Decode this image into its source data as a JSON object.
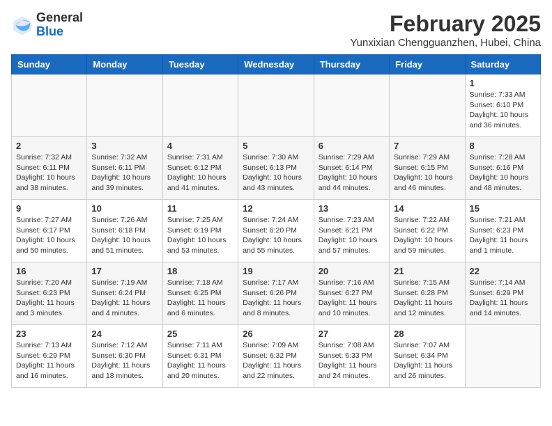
{
  "header": {
    "logo_general": "General",
    "logo_blue": "Blue",
    "month_title": "February 2025",
    "subtitle": "Yunxixian Chengguanzhen, Hubei, China"
  },
  "weekdays": [
    "Sunday",
    "Monday",
    "Tuesday",
    "Wednesday",
    "Thursday",
    "Friday",
    "Saturday"
  ],
  "weeks": [
    [
      {
        "day": "",
        "info": ""
      },
      {
        "day": "",
        "info": ""
      },
      {
        "day": "",
        "info": ""
      },
      {
        "day": "",
        "info": ""
      },
      {
        "day": "",
        "info": ""
      },
      {
        "day": "",
        "info": ""
      },
      {
        "day": "1",
        "info": "Sunrise: 7:33 AM\nSunset: 6:10 PM\nDaylight: 10 hours\nand 36 minutes."
      }
    ],
    [
      {
        "day": "2",
        "info": "Sunrise: 7:32 AM\nSunset: 6:11 PM\nDaylight: 10 hours\nand 38 minutes."
      },
      {
        "day": "3",
        "info": "Sunrise: 7:32 AM\nSunset: 6:11 PM\nDaylight: 10 hours\nand 39 minutes."
      },
      {
        "day": "4",
        "info": "Sunrise: 7:31 AM\nSunset: 6:12 PM\nDaylight: 10 hours\nand 41 minutes."
      },
      {
        "day": "5",
        "info": "Sunrise: 7:30 AM\nSunset: 6:13 PM\nDaylight: 10 hours\nand 43 minutes."
      },
      {
        "day": "6",
        "info": "Sunrise: 7:29 AM\nSunset: 6:14 PM\nDaylight: 10 hours\nand 44 minutes."
      },
      {
        "day": "7",
        "info": "Sunrise: 7:29 AM\nSunset: 6:15 PM\nDaylight: 10 hours\nand 46 minutes."
      },
      {
        "day": "8",
        "info": "Sunrise: 7:28 AM\nSunset: 6:16 PM\nDaylight: 10 hours\nand 48 minutes."
      }
    ],
    [
      {
        "day": "9",
        "info": "Sunrise: 7:27 AM\nSunset: 6:17 PM\nDaylight: 10 hours\nand 50 minutes."
      },
      {
        "day": "10",
        "info": "Sunrise: 7:26 AM\nSunset: 6:18 PM\nDaylight: 10 hours\nand 51 minutes."
      },
      {
        "day": "11",
        "info": "Sunrise: 7:25 AM\nSunset: 6:19 PM\nDaylight: 10 hours\nand 53 minutes."
      },
      {
        "day": "12",
        "info": "Sunrise: 7:24 AM\nSunset: 6:20 PM\nDaylight: 10 hours\nand 55 minutes."
      },
      {
        "day": "13",
        "info": "Sunrise: 7:23 AM\nSunset: 6:21 PM\nDaylight: 10 hours\nand 57 minutes."
      },
      {
        "day": "14",
        "info": "Sunrise: 7:22 AM\nSunset: 6:22 PM\nDaylight: 10 hours\nand 59 minutes."
      },
      {
        "day": "15",
        "info": "Sunrise: 7:21 AM\nSunset: 6:23 PM\nDaylight: 11 hours\nand 1 minute."
      }
    ],
    [
      {
        "day": "16",
        "info": "Sunrise: 7:20 AM\nSunset: 6:23 PM\nDaylight: 11 hours\nand 3 minutes."
      },
      {
        "day": "17",
        "info": "Sunrise: 7:19 AM\nSunset: 6:24 PM\nDaylight: 11 hours\nand 4 minutes."
      },
      {
        "day": "18",
        "info": "Sunrise: 7:18 AM\nSunset: 6:25 PM\nDaylight: 11 hours\nand 6 minutes."
      },
      {
        "day": "19",
        "info": "Sunrise: 7:17 AM\nSunset: 6:26 PM\nDaylight: 11 hours\nand 8 minutes."
      },
      {
        "day": "20",
        "info": "Sunrise: 7:16 AM\nSunset: 6:27 PM\nDaylight: 11 hours\nand 10 minutes."
      },
      {
        "day": "21",
        "info": "Sunrise: 7:15 AM\nSunset: 6:28 PM\nDaylight: 11 hours\nand 12 minutes."
      },
      {
        "day": "22",
        "info": "Sunrise: 7:14 AM\nSunset: 6:29 PM\nDaylight: 11 hours\nand 14 minutes."
      }
    ],
    [
      {
        "day": "23",
        "info": "Sunrise: 7:13 AM\nSunset: 6:29 PM\nDaylight: 11 hours\nand 16 minutes."
      },
      {
        "day": "24",
        "info": "Sunrise: 7:12 AM\nSunset: 6:30 PM\nDaylight: 11 hours\nand 18 minutes."
      },
      {
        "day": "25",
        "info": "Sunrise: 7:11 AM\nSunset: 6:31 PM\nDaylight: 11 hours\nand 20 minutes."
      },
      {
        "day": "26",
        "info": "Sunrise: 7:09 AM\nSunset: 6:32 PM\nDaylight: 11 hours\nand 22 minutes."
      },
      {
        "day": "27",
        "info": "Sunrise: 7:08 AM\nSunset: 6:33 PM\nDaylight: 11 hours\nand 24 minutes."
      },
      {
        "day": "28",
        "info": "Sunrise: 7:07 AM\nSunset: 6:34 PM\nDaylight: 11 hours\nand 26 minutes."
      },
      {
        "day": "",
        "info": ""
      }
    ]
  ]
}
